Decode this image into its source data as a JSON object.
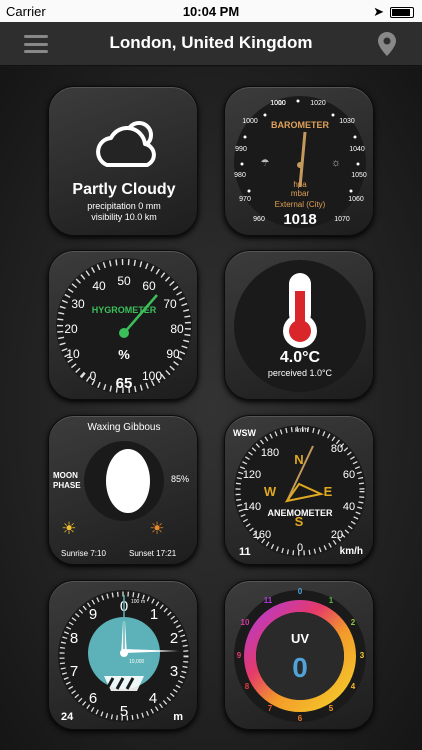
{
  "status": {
    "carrier": "Carrier",
    "time": "10:04 PM"
  },
  "nav": {
    "title": "London, United Kingdom"
  },
  "weather": {
    "condition": "Partly Cloudy",
    "precipitation": "precipitation  0 mm",
    "visibility": "visibility 10.0 km"
  },
  "barometer": {
    "label": "BAROMETER",
    "unit1": "hpa",
    "unit2": "mbar",
    "source": "External (City)",
    "value": "1018",
    "ticks": [
      "1010",
      "1020",
      "1030",
      "1040",
      "1050",
      "1060",
      "1070",
      "960",
      "970",
      "980",
      "990",
      "1000"
    ]
  },
  "hygrometer": {
    "label": "HYGROMETER",
    "unit": "%",
    "value": "65",
    "ticks": [
      "0",
      "10",
      "20",
      "30",
      "40",
      "50",
      "60",
      "70",
      "80",
      "90",
      "100"
    ]
  },
  "thermometer": {
    "value": "4.0°C",
    "perceived": "perceived 1.0°C"
  },
  "moon": {
    "phase": "Waxing Gibbous",
    "label1": "MOON",
    "label2": "PHASE",
    "illumination": "85%",
    "sunrise": "Sunrise 7:10",
    "sunset": "Sunset 17:21"
  },
  "anemometer": {
    "label": "ANEMOMETER",
    "direction": "WSW",
    "unit_top": "km/h",
    "value": "11",
    "unit": "km/h",
    "ticks": [
      "0",
      "20",
      "40",
      "60",
      "80",
      "100",
      "120",
      "140",
      "160",
      "180"
    ],
    "compass": [
      "N",
      "E",
      "S",
      "W"
    ]
  },
  "altimeter": {
    "value": "24",
    "unit": "m",
    "ticks": [
      "0",
      "1",
      "2",
      "3",
      "4",
      "5",
      "6",
      "7",
      "8",
      "9"
    ],
    "small_top": "100",
    "small_unit": "m",
    "small_mid": "10,000"
  },
  "uv": {
    "label": "UV",
    "value": "0",
    "ticks": [
      "0",
      "1",
      "2",
      "3",
      "4",
      "5",
      "6",
      "7",
      "8",
      "9",
      "10",
      "11"
    ]
  }
}
